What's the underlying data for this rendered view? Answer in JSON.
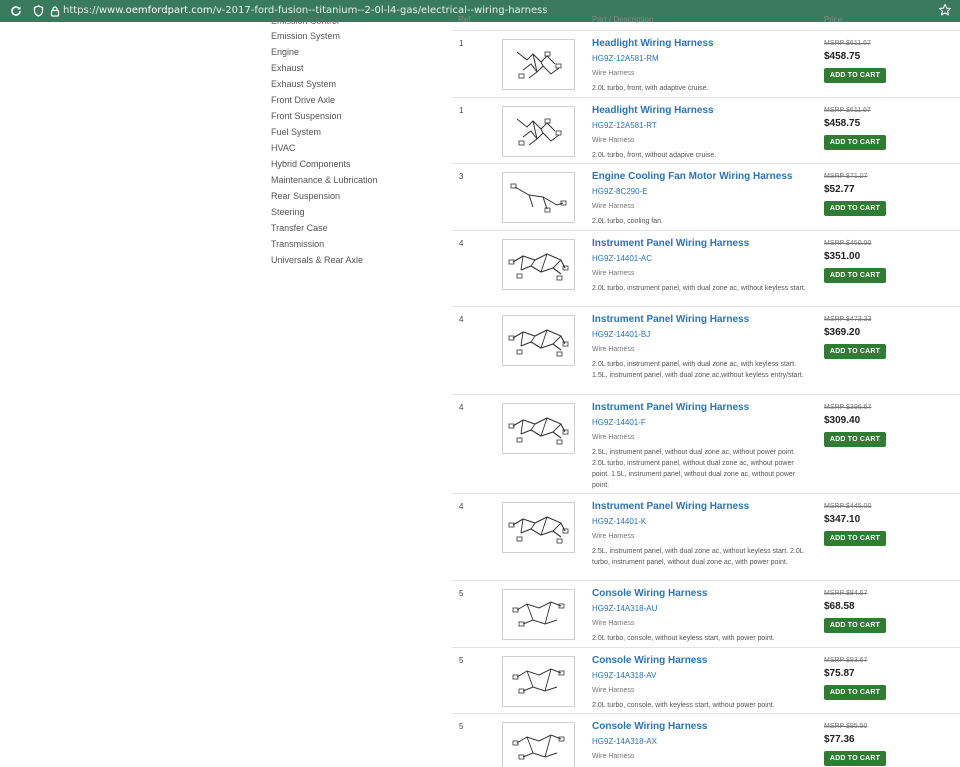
{
  "browser": {
    "url_prefix": "https://www.",
    "url_domain": "oemfordpart.com",
    "url_path": "/v-2017-ford-fusion--titanium--2-0l-l4-gas/electrical--wiring-harness"
  },
  "columns": {
    "ref": "Ref",
    "part": "Part / Description",
    "price": "Price"
  },
  "categories": [
    "Emission Control",
    "Emission System",
    "Engine",
    "Exhaust",
    "Exhaust System",
    "Front Drive Axle",
    "Front Suspension",
    "Fuel System",
    "HVAC",
    "Hybrid Components",
    "Maintenance & Lubrication",
    "Rear Suspension",
    "Steering",
    "Transfer Case",
    "Transmission",
    "Universals & Rear Axle"
  ],
  "button_label": "ADD TO CART",
  "parts": [
    {
      "ref": "1",
      "name": "Headlight Wiring Harness",
      "part_no": "HG9Z-12A581-RM",
      "type": "Wire Harness",
      "desc": "2.0L turbo, front, with adaptive cruise.",
      "msrp": "MSRP $611.67",
      "price": "$458.75",
      "icon": "headlight-harness"
    },
    {
      "ref": "1",
      "name": "Headlight Wiring Harness",
      "part_no": "HG9Z-12A581-RT",
      "type": "Wire Harness",
      "desc": "2.0L turbo, front, without adapive cruise.",
      "msrp": "MSRP $611.67",
      "price": "$458.75",
      "icon": "headlight-harness"
    },
    {
      "ref": "3",
      "name": "Engine Cooling Fan Motor Wiring Harness",
      "part_no": "HG9Z-8C290-E",
      "type": "Wire Harness",
      "desc": "2.0L turbo, cooling fan.",
      "msrp": "MSRP $71.07",
      "price": "$52.77",
      "icon": "fan-harness"
    },
    {
      "ref": "4",
      "name": "Instrument Panel Wiring Harness",
      "part_no": "HG9Z-14401-AC",
      "type": "Wire Harness",
      "desc": "2.0L turbo, instrument panel, with dual zone ac, without keyless start.",
      "msrp": "MSRP $450.00",
      "price": "$351.00",
      "icon": "panel-harness"
    },
    {
      "ref": "4",
      "name": "Instrument Panel Wiring Harness",
      "part_no": "HG9Z-14401-BJ",
      "type": "Wire Harness",
      "desc": "2.0L turbo, instrument panel, with dual zone ac, with keyless start. 1.5L, instrument panel, with dual zone ac,without keyless entry/start.",
      "msrp": "MSRP $473.33",
      "price": "$369.20",
      "icon": "panel-harness"
    },
    {
      "ref": "4",
      "name": "Instrument Panel Wiring Harness",
      "part_no": "HG9Z-14401-F",
      "type": "Wire Harness",
      "desc": "2.5L, instrument panel, without dual zone ac, without power point. 2.0L turbo, instrument panel, without dual zone ac, without power point. 1.5L, instrument panel, without dual zone ac, without power point.",
      "msrp": "MSRP $396.67",
      "price": "$309.40",
      "icon": "panel-harness"
    },
    {
      "ref": "4",
      "name": "Instrument Panel Wiring Harness",
      "part_no": "HG9Z-14401-K",
      "type": "Wire Harness",
      "desc": "2.5L, instrument panel, with dual zone ac, without keyless start. 2.0L turbo, instrument panel, without dual zone ac, with power point.",
      "msrp": "MSRP $445.00",
      "price": "$347.10",
      "icon": "panel-harness"
    },
    {
      "ref": "5",
      "name": "Console Wiring Harness",
      "part_no": "HG9Z-14A318-AU",
      "type": "Wire Harness",
      "desc": "2.0L turbo, console, without keyless start, with power point.",
      "msrp": "MSRP $84.67",
      "price": "$68.58",
      "icon": "console-harness"
    },
    {
      "ref": "5",
      "name": "Console Wiring Harness",
      "part_no": "HG9Z-14A318-AV",
      "type": "Wire Harness",
      "desc": "2.0L turbo, console, with keyless start, without power point.",
      "msrp": "MSRP $93.67",
      "price": "$75.87",
      "icon": "console-harness"
    },
    {
      "ref": "5",
      "name": "Console Wiring Harness",
      "part_no": "HG9Z-14A318-AX",
      "type": "Wire Harness",
      "desc": "",
      "msrp": "MSRP $95.50",
      "price": "$77.36",
      "icon": "console-harness"
    }
  ]
}
